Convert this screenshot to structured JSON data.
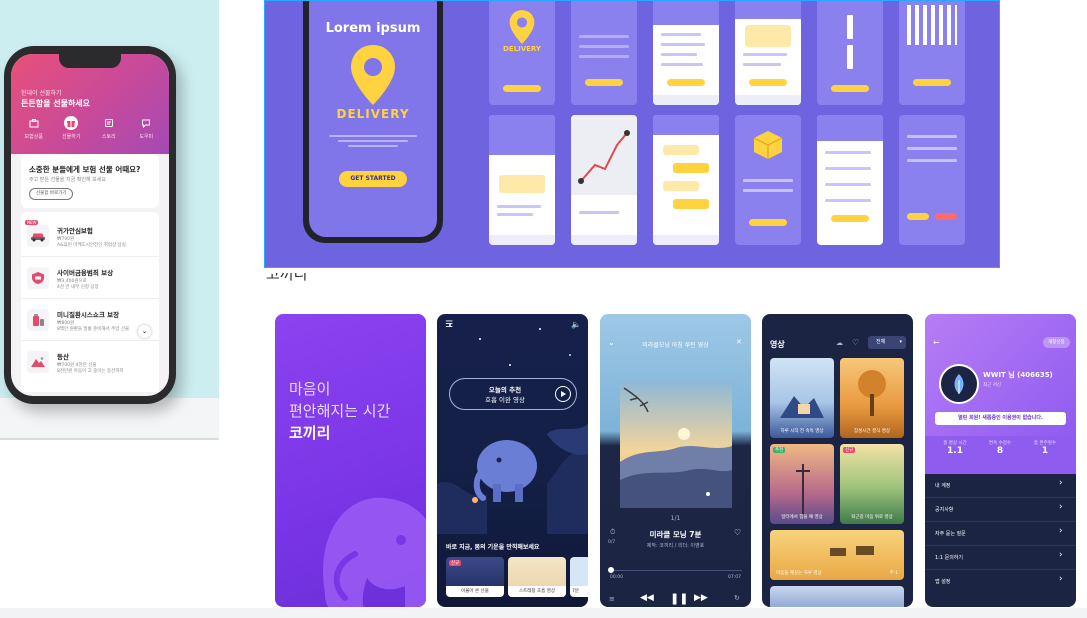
{
  "insurance": {
    "header_line1": "현대이 선물하기",
    "header_line2": "든든함을 선물하세요",
    "tabs": [
      {
        "label": "보험상품",
        "icon": "briefcase-icon"
      },
      {
        "label": "선물하기",
        "icon": "gift-icon"
      },
      {
        "label": "스토리",
        "icon": "story-icon"
      },
      {
        "label": "도우미",
        "icon": "helper-icon"
      }
    ],
    "active_tab": "선물하기",
    "card_title": "소중한 분들에게 보험 선물 어때요?",
    "card_subtitle": "주고 받은 선물을 지금 확인해 보세요",
    "card_button": "선물함 바로가기",
    "items": [
      {
        "name": "귀가안심보험",
        "line1": "₩700원",
        "line2": "A&휴먼 마케도시안전인 취업상 상실",
        "badge": "NEW",
        "icon": "car-icon"
      },
      {
        "name": "사이버금융범죄 보상",
        "line1": "₩3,400원으로",
        "line2": "4천 만 내부 인정 상장",
        "badge": "",
        "icon": "shield-icon"
      },
      {
        "name": "미니질환시스쇼크 보장",
        "line1": "₩800원",
        "line2": "8백만 원환을 멀통 준비해서 주방 선물",
        "badge": "",
        "icon": "medicine-icon"
      },
      {
        "name": "등산",
        "line1": "₩700원 4천만 선물",
        "line2": "8천만원 마음이 고 중이는 등산까지",
        "badge": "",
        "icon": "mountain-icon"
      }
    ]
  },
  "delivery": {
    "hero_title": "Lorem ipsum",
    "hero_brand": "DELIVERY",
    "hero_button": "GET STARTED",
    "mini_brand": "DELIVERY",
    "accent": "#ffd23f",
    "bg": "#6e64e0"
  },
  "kokkiri": {
    "cut_label": "코끼리",
    "splash_line1": "마음이",
    "splash_line2": "편안해지는 시간",
    "splash_brand": "코끼리",
    "home": {
      "rec_line1": "오늘의 추천",
      "rec_line2": "호흡 이완 영상",
      "section": "바로 지금, 봄의 기운을 만끽해보세요",
      "thumbs": [
        {
          "label": "이불어 온 선물",
          "badge": "신규"
        },
        {
          "label": "스트레칭 호흡 영상",
          "badge": ""
        },
        {
          "label": "7분",
          "badge": ""
        }
      ]
    },
    "player": {
      "header": "미라클모닝 아침 루틴 영상",
      "counter": "1/1",
      "title": "미라클 모닝 7분",
      "subtitle": "제작: 코끼리 / 리더: 이영호",
      "time_start": "00:00",
      "time_end": "07:07",
      "side_left": "0/7"
    },
    "videos": {
      "title": "영상",
      "filter": "전체",
      "items": [
        {
          "label": "하루 시작 전 속독 영상",
          "badge": ""
        },
        {
          "label": "잠성시간 결식 영상",
          "badge": ""
        },
        {
          "label": "일터에서 힘을 예 영상",
          "badge": "추천"
        },
        {
          "label": "퇴근길 마음 위로 영상",
          "badge": "신규"
        },
        {
          "label": "마음을 깨끗는 하루 영상",
          "badge": "",
          "extra": "주·1"
        }
      ]
    },
    "profile": {
      "top_button": "개정신청",
      "name": "WWIT 님 (406635)",
      "sub": "최근 서신",
      "notice": "열린 회원! 새롭중인 이용권이 없습니다.",
      "stats": [
        {
          "label": "총 명상 시간",
          "value": "1.1"
        },
        {
          "label": "연속 수업수",
          "value": "8"
        },
        {
          "label": "총 완주횟수",
          "value": "1"
        }
      ],
      "menu": [
        "내 계정",
        "공지사항",
        "자주 묻는 질문",
        "1:1 문의하기",
        "앱 설정"
      ]
    }
  }
}
